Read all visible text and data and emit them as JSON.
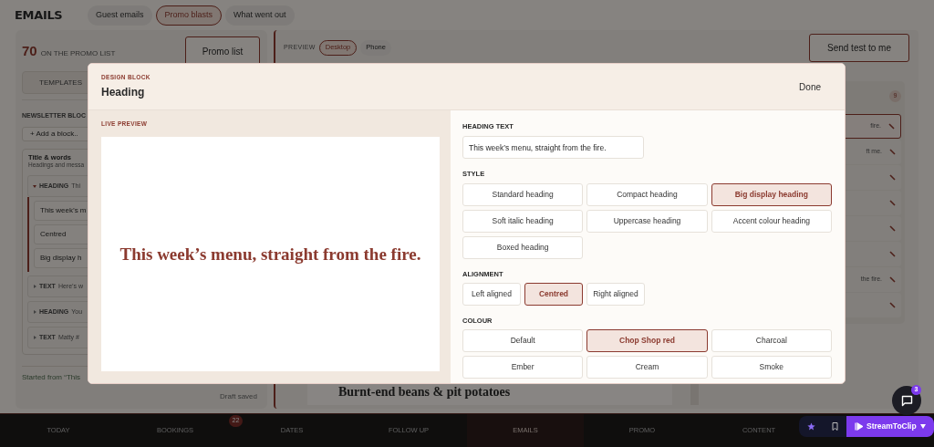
{
  "header": {
    "title": "EMAILS",
    "tabs": [
      {
        "label": "Guest emails",
        "selected": false
      },
      {
        "label": "Promo blasts",
        "selected": true
      },
      {
        "label": "What went out",
        "selected": false
      }
    ]
  },
  "promo_panel": {
    "count": "70",
    "count_label": "ON THE PROMO LIST",
    "list_button": "Promo list",
    "tab": "TEMPLATES",
    "section_title": "NEWSLETTER BLOC",
    "add_block": "+ Add a block..",
    "group": {
      "title": "Title & words",
      "subtitle": "Headings and messa",
      "blocks": [
        {
          "type": "HEADING",
          "snippet": "Thi",
          "expanded": true,
          "fields": [
            "This week’s m",
            "Centred",
            "Big display h"
          ]
        },
        {
          "type": "TEXT",
          "snippet": "Here’s w",
          "expanded": false
        },
        {
          "type": "HEADING",
          "snippet": "You",
          "expanded": false
        },
        {
          "type": "TEXT",
          "snippet": "Matty #",
          "expanded": false
        }
      ]
    },
    "started_from": "Started from “This",
    "status": "Draft saved"
  },
  "preview": {
    "label": "PREVIEW",
    "devices": [
      {
        "label": "Desktop",
        "selected": true
      },
      {
        "label": "Phone",
        "selected": false
      }
    ],
    "send_test": "Send test to me",
    "block_count": "9",
    "block_rows": [
      {
        "snippet": "fire.",
        "selected": true
      },
      {
        "snippet": "ft me.",
        "selected": false
      },
      {
        "selected": false
      },
      {
        "selected": false
      },
      {
        "selected": false
      },
      {
        "selected": false
      },
      {
        "snippet": "the fire.",
        "selected": false
      },
      {
        "selected": false
      }
    ],
    "content_heading": "Burnt-end beans & pit potatoes"
  },
  "modal": {
    "eyebrow": "DESIGN BLOCK",
    "title": "Heading",
    "done": "Done",
    "preview_label": "LIVE PREVIEW",
    "preview_text": "This week’s menu, straight from the fire.",
    "heading_text": {
      "label": "HEADING TEXT",
      "value": "This week’s menu, straight from the fire."
    },
    "style": {
      "label": "STYLE",
      "options": [
        {
          "label": "Standard heading",
          "selected": false
        },
        {
          "label": "Compact heading",
          "selected": false
        },
        {
          "label": "Big display heading",
          "selected": true
        },
        {
          "label": "Soft italic heading",
          "selected": false
        },
        {
          "label": "Uppercase heading",
          "selected": false
        },
        {
          "label": "Accent colour heading",
          "selected": false
        },
        {
          "label": "Boxed heading",
          "selected": false
        }
      ]
    },
    "alignment": {
      "label": "ALIGNMENT",
      "options": [
        {
          "label": "Left aligned",
          "selected": false
        },
        {
          "label": "Centred",
          "selected": true
        },
        {
          "label": "Right aligned",
          "selected": false
        }
      ]
    },
    "colour": {
      "label": "COLOUR",
      "options": [
        {
          "label": "Default",
          "selected": false
        },
        {
          "label": "Chop Shop red",
          "selected": true
        },
        {
          "label": "Charcoal",
          "selected": false
        },
        {
          "label": "Ember",
          "selected": false
        },
        {
          "label": "Cream",
          "selected": false
        },
        {
          "label": "Smoke",
          "selected": false
        }
      ]
    }
  },
  "bottom_nav": [
    {
      "label": "TODAY",
      "selected": false
    },
    {
      "label": "BOOKINGS",
      "selected": false,
      "badge": "22"
    },
    {
      "label": "DATES",
      "selected": false
    },
    {
      "label": "FOLLOW UP",
      "selected": false
    },
    {
      "label": "EMAILS",
      "selected": true
    },
    {
      "label": "PROMO",
      "selected": false
    },
    {
      "label": "CONTENT",
      "selected": false
    }
  ],
  "widget": {
    "label": "StreamToClip"
  },
  "chat": {
    "badge": "3"
  }
}
